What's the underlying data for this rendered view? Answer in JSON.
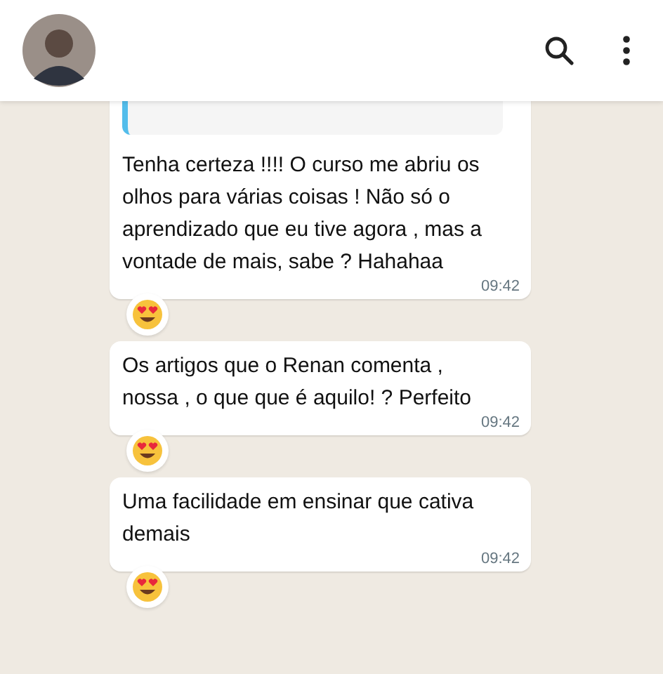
{
  "messages": [
    {
      "quoted": true,
      "text": "Tenha certeza !!!! O curso me abriu os olhos para várias coisas ! Não só o aprendizado que eu tive agora , mas a vontade de mais, sabe ? Hahahaa",
      "time": "09:42",
      "reacted": true
    },
    {
      "quoted": false,
      "text": "Os artigos que o Renan comenta , nossa , o que que é aquilo! ? Perfeito",
      "time": "09:42",
      "reacted": true
    },
    {
      "quoted": false,
      "text": "Uma facilidade em ensinar que cativa demais",
      "time": "09:42",
      "reacted": true
    }
  ]
}
